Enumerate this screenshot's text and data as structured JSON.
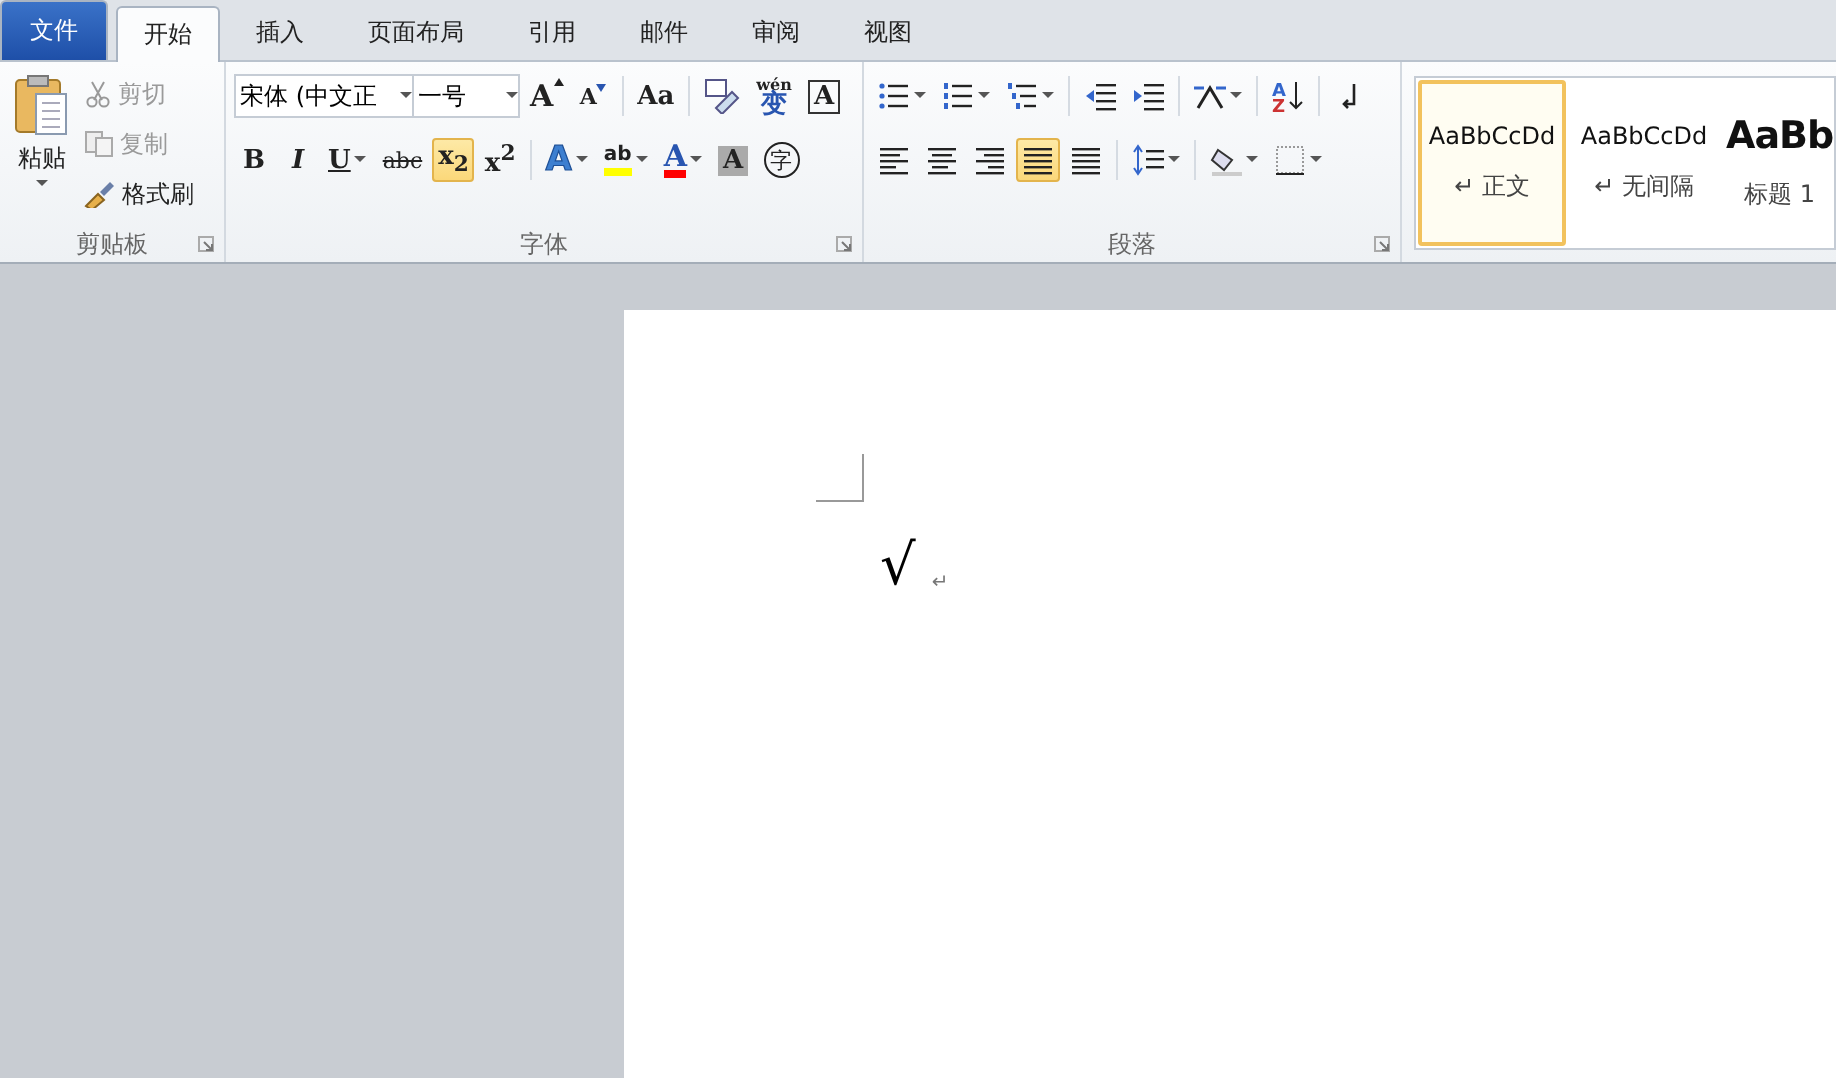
{
  "tabs": [
    {
      "label": "文件",
      "kind": "file",
      "selected": false
    },
    {
      "label": "开始",
      "kind": "tab",
      "selected": true
    },
    {
      "label": "插入",
      "kind": "tab",
      "selected": false
    },
    {
      "label": "页面布局",
      "kind": "tab",
      "selected": false
    },
    {
      "label": "引用",
      "kind": "tab",
      "selected": false
    },
    {
      "label": "邮件",
      "kind": "tab",
      "selected": false
    },
    {
      "label": "审阅",
      "kind": "tab",
      "selected": false
    },
    {
      "label": "视图",
      "kind": "tab",
      "selected": false
    }
  ],
  "clipboard": {
    "title": "剪贴板",
    "paste": {
      "label": "粘贴"
    },
    "items": [
      {
        "label": "剪切",
        "kind": "cut",
        "disabled": true
      },
      {
        "label": "复制",
        "kind": "copy",
        "disabled": true
      },
      {
        "label": "格式刷",
        "kind": "painter",
        "disabled": false
      }
    ]
  },
  "font": {
    "title": "字体",
    "font_name": "宋体 (中文正",
    "font_size": "一号",
    "row1": [
      {
        "kind": "grow",
        "label": "A"
      },
      {
        "kind": "shrink",
        "label": "A"
      },
      {
        "kind": "case",
        "label": "Aa"
      },
      {
        "kind": "clear"
      },
      {
        "kind": "pinyin",
        "label": "wén",
        "sub": "变"
      },
      {
        "kind": "border",
        "label": "A"
      }
    ],
    "row2": [
      {
        "kind": "bold",
        "label": "B",
        "selected": false
      },
      {
        "kind": "italic",
        "label": "I",
        "selected": false
      },
      {
        "kind": "underline",
        "label": "U",
        "selected": false
      },
      {
        "kind": "strike",
        "label": "abc",
        "selected": false
      },
      {
        "kind": "subscript",
        "label": "x$_{2}$",
        "selected": true
      },
      {
        "kind": "superscript",
        "label": "x$^{2}$",
        "selected": false
      },
      {
        "kind": "effect",
        "label": "A",
        "selected": false
      },
      {
        "kind": "highlight",
        "label": "ab",
        "color": "#ffff00",
        "selected": false
      },
      {
        "kind": "color",
        "label": "A",
        "color": "#ff0000",
        "selected": false
      },
      {
        "kind": "shade",
        "label": "A",
        "selected": false
      },
      {
        "kind": "enclose",
        "label": "字",
        "selected": false
      }
    ]
  },
  "paragraph": {
    "title": "段落",
    "row1": [
      {
        "kind": "bullets"
      },
      {
        "kind": "numbering"
      },
      {
        "kind": "multilevel"
      },
      {
        "kind": "outdent"
      },
      {
        "kind": "indent"
      },
      {
        "kind": "asian"
      },
      {
        "kind": "sort",
        "label": "A",
        "sub": "Z"
      },
      {
        "kind": "marks"
      }
    ],
    "row2": [
      {
        "kind": "left",
        "selected": false
      },
      {
        "kind": "center",
        "selected": false
      },
      {
        "kind": "right",
        "selected": false
      },
      {
        "kind": "justify",
        "selected": true
      },
      {
        "kind": "distribute",
        "selected": false
      },
      {
        "kind": "spacing",
        "selected": false
      },
      {
        "kind": "fill",
        "selected": false
      },
      {
        "kind": "borders",
        "selected": false
      }
    ]
  },
  "styles": [
    {
      "preview": "AaBbCcDd",
      "name": "正文",
      "mark": "↵",
      "kind": "normal",
      "selected": true
    },
    {
      "preview": "AaBbCcDd",
      "name": "无间隔",
      "mark": "↵",
      "kind": "normal",
      "selected": false
    },
    {
      "preview": "AaBb",
      "name": "标题 1",
      "kind": "heading",
      "selected": false
    }
  ],
  "document": {
    "text": "√",
    "mark": "↵"
  }
}
